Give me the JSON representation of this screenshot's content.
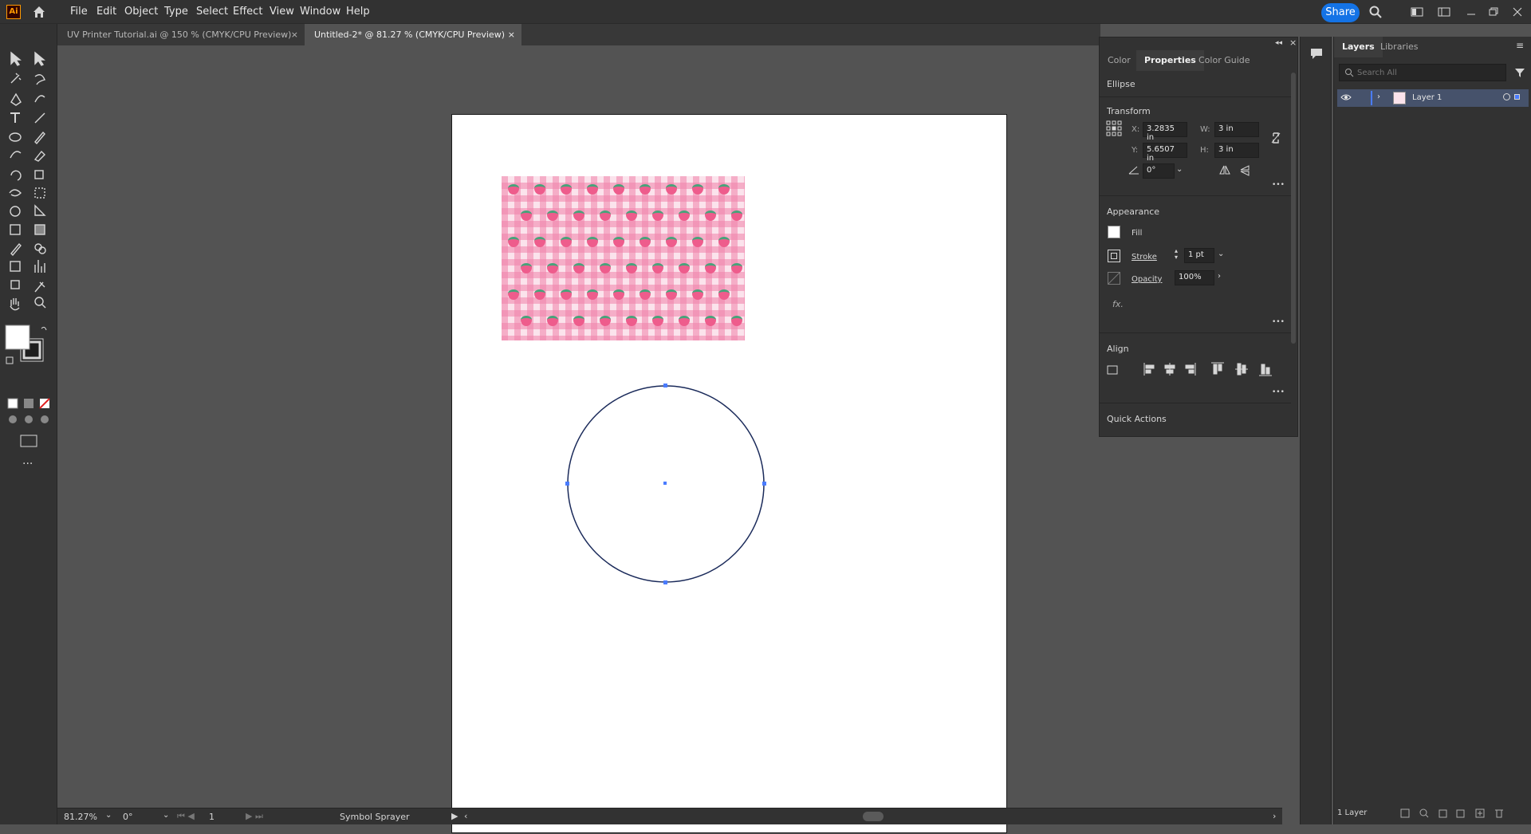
{
  "app": {
    "logo": "Ai",
    "menu": [
      "File",
      "Edit",
      "Object",
      "Type",
      "Select",
      "Effect",
      "View",
      "Window",
      "Help"
    ],
    "share_label": "Share"
  },
  "tabs": [
    {
      "label": "UV Printer Tutorial.ai @ 150 % (CMYK/CPU Preview)",
      "close": "×"
    },
    {
      "label": "Untitled-2* @ 81.27 % (CMYK/CPU Preview)",
      "close": "×"
    }
  ],
  "properties": {
    "tabs": [
      "Color",
      "Properties",
      "Color Guide"
    ],
    "object_type": "Ellipse",
    "transform": {
      "title": "Transform",
      "x_label": "X:",
      "x_value": "3.2835 in",
      "y_label": "Y:",
      "y_value": "5.6507 in",
      "w_label": "W:",
      "w_value": "3 in",
      "h_label": "H:",
      "h_value": "3 in",
      "angle_value": "0°"
    },
    "appearance": {
      "title": "Appearance",
      "fill_label": "Fill",
      "stroke_label": "Stroke",
      "stroke_value": "1 pt",
      "opacity_label": "Opacity",
      "opacity_value": "100%",
      "fx_label": "fx."
    },
    "align_title": "Align",
    "quick_actions_title": "Quick Actions",
    "more": "•••"
  },
  "layers": {
    "tabs": [
      "Layers",
      "Libraries"
    ],
    "search_placeholder": "Search All",
    "layer_name": "Layer 1",
    "count": "1 Layer"
  },
  "status": {
    "zoom": "81.27%",
    "rotation": "0°",
    "artboard": "1",
    "tool": "Symbol Sprayer"
  },
  "colors": {
    "accent": "#1473e6",
    "selection": "#4a7cff"
  }
}
